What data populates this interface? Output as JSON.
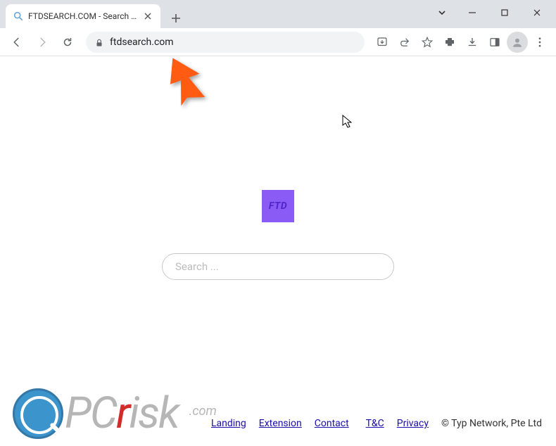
{
  "browser": {
    "tab": {
      "title": "FTDSEARCH.COM - Search Anyth",
      "favicon": "search-icon"
    },
    "url": "ftdsearch.com"
  },
  "page": {
    "logo_text": "FTD",
    "search_placeholder": "Search ..."
  },
  "footer": {
    "links": [
      {
        "label": "Landing"
      },
      {
        "label": "Extension"
      },
      {
        "label": "Contact"
      },
      {
        "label": "T&C"
      },
      {
        "label": "Privacy"
      }
    ],
    "copyright": "© Typ Network, Pte Ltd"
  },
  "watermark": {
    "text_prefix": "PC",
    "text_accent": "r",
    "text_suffix": "isk",
    "dotcom": ".com"
  }
}
